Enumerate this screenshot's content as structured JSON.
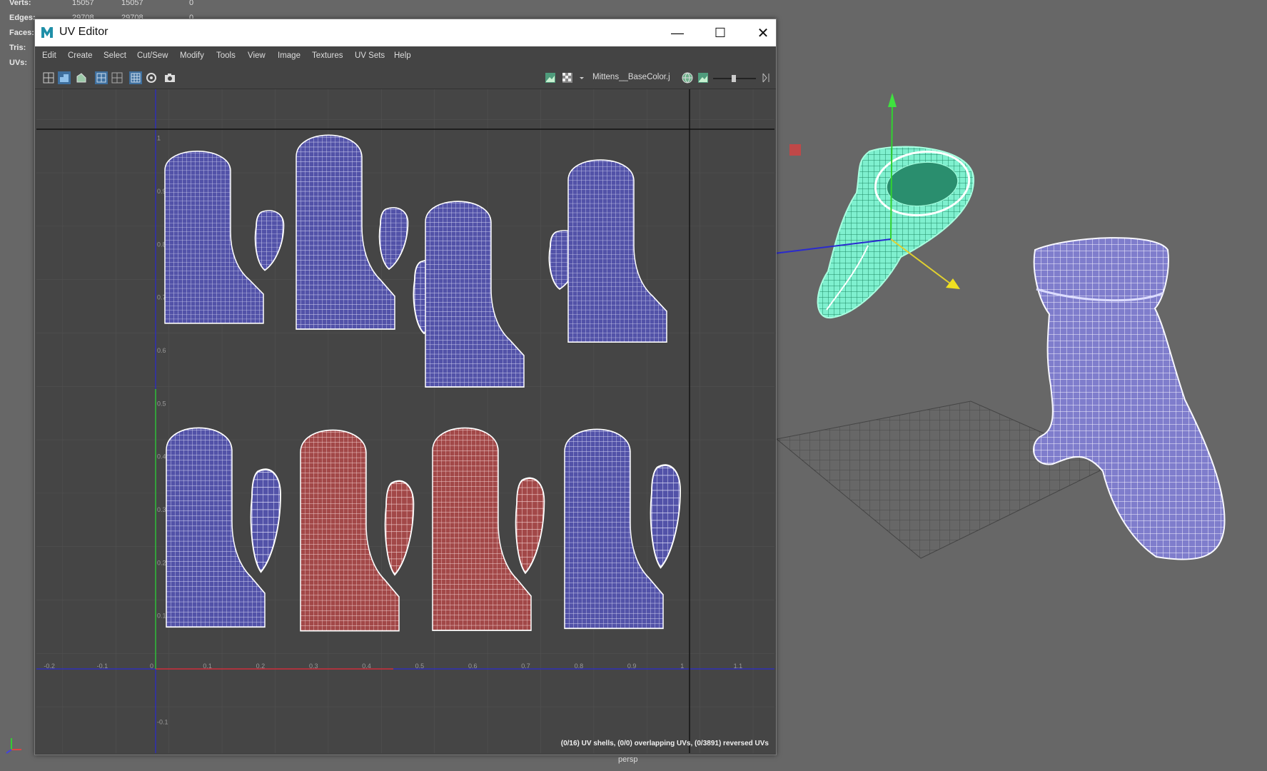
{
  "hud": {
    "rows": [
      {
        "label": "Verts:",
        "v1": "15057",
        "v2": "15057",
        "v3": "0"
      },
      {
        "label": "Edges:",
        "v1": "29708",
        "v2": "29708",
        "v3": "0"
      },
      {
        "label": "Faces:",
        "v1": "",
        "v2": "",
        "v3": ""
      },
      {
        "label": "Tris:",
        "v1": "",
        "v2": "",
        "v3": ""
      },
      {
        "label": "UVs:",
        "v1": "",
        "v2": "",
        "v3": ""
      }
    ]
  },
  "window": {
    "title": "UV Editor",
    "minimize": "—",
    "maximize": "☐",
    "close": "✕"
  },
  "menu": [
    "Edit",
    "Create",
    "Select",
    "Cut/Sew",
    "Modify",
    "Tools",
    "View",
    "Image",
    "Textures",
    "UV Sets",
    "Help"
  ],
  "toolbar": {
    "texture_name": "Mittens__BaseColor.j"
  },
  "grid": {
    "x_ticks": [
      "-0.2",
      "-0.1",
      "0",
      "0.1",
      "0.2",
      "0.3",
      "0.4",
      "0.5",
      "0.6",
      "0.7",
      "0.8",
      "0.9",
      "1",
      "1.1"
    ],
    "y_ticks": [
      "1",
      "0.9",
      "0.8",
      "0.7",
      "0.6",
      "0.5",
      "0.4",
      "0.3",
      "0.2",
      "0.1",
      "-0.1"
    ]
  },
  "status": "(0/16) UV shells, (0/0) overlapping UVs, (0/3891) reversed UVs",
  "camera_label": "persp",
  "colors": {
    "shell_blue": "#5a5ab8",
    "shell_red": "#b05050",
    "mesh_green": "#3cf0b0",
    "mesh_blue": "#7a78c8"
  }
}
